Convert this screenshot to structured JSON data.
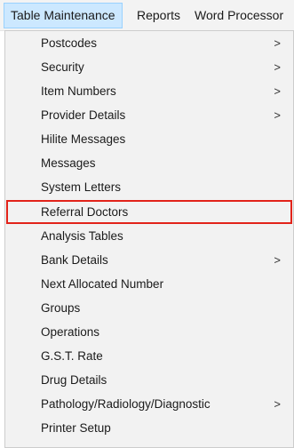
{
  "menubar": {
    "items": [
      {
        "label": "Table Maintenance",
        "active": true
      },
      {
        "label": "Reports",
        "active": false
      },
      {
        "label": "Word Processor",
        "active": false
      }
    ]
  },
  "dropdown": {
    "items": [
      {
        "label": "Postcodes",
        "submenu": true
      },
      {
        "label": "Security",
        "submenu": true
      },
      {
        "label": "Item Numbers",
        "submenu": true
      },
      {
        "label": "Provider Details",
        "submenu": true
      },
      {
        "label": "Hilite Messages",
        "submenu": false
      },
      {
        "label": "Messages",
        "submenu": false
      },
      {
        "label": "System Letters",
        "submenu": false
      },
      {
        "label": "Referral Doctors",
        "submenu": false,
        "highlighted": true
      },
      {
        "label": "Analysis Tables",
        "submenu": false
      },
      {
        "label": "Bank Details",
        "submenu": true
      },
      {
        "label": "Next Allocated Number",
        "submenu": false
      },
      {
        "label": "Groups",
        "submenu": false
      },
      {
        "label": "Operations",
        "submenu": false
      },
      {
        "label": "G.S.T. Rate",
        "submenu": false
      },
      {
        "label": "Drug Details",
        "submenu": false
      },
      {
        "label": "Pathology/Radiology/Diagnostic",
        "submenu": true
      },
      {
        "label": "Printer Setup",
        "submenu": false
      }
    ],
    "submenu_glyph": ">"
  },
  "colors": {
    "active_menu_bg": "#cce8ff",
    "highlight_border": "#e2231a"
  }
}
